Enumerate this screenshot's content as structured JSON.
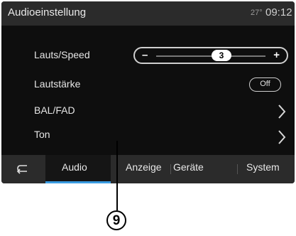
{
  "header": {
    "title": "Audioeinstellung",
    "temperature": "27°",
    "time": "09:12"
  },
  "settings": [
    {
      "label": "Lauts/Speed",
      "control": "stepper",
      "minus": "–",
      "plus": "+",
      "value": "3"
    },
    {
      "label": "Lautstärke",
      "control": "toggle",
      "value": "Off"
    },
    {
      "label": "BAL/FAD",
      "control": "chevron-right-icon"
    },
    {
      "label": "Ton",
      "control": "chevron-right-icon"
    }
  ],
  "tabs": [
    {
      "label": "back-arrow-icon",
      "icon": true
    },
    {
      "label": "Audio",
      "active": true
    },
    {
      "label": "Anzeige"
    },
    {
      "label": "Geräte"
    },
    {
      "label": "System"
    }
  ],
  "callout": {
    "number": "9"
  },
  "colors": {
    "screen": "#000000",
    "bar": "#2b2b2b",
    "accent": "#3a9be0",
    "text": "#e8e8e8"
  }
}
